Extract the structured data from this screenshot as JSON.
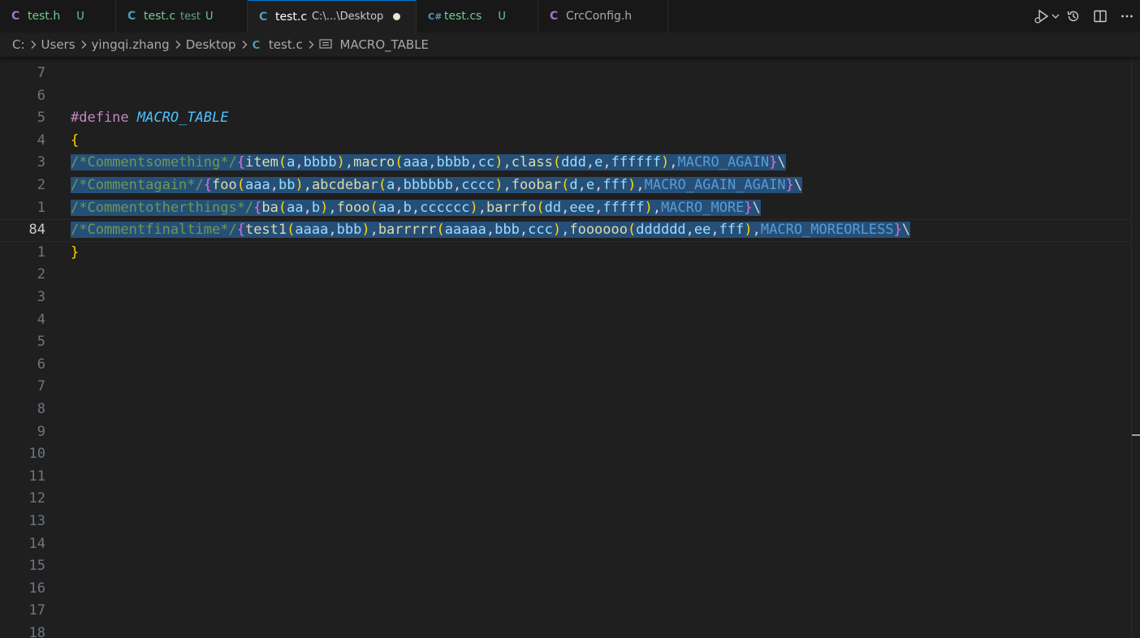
{
  "colors": {
    "tab_c_icon": "#519aba",
    "tab_h_icon": "#a074c4",
    "tab_untracked": "#73c991",
    "keyword": "#c586c0",
    "macro_name": "#4fc1ff",
    "brace": "#ffd700",
    "paren": "#da70d6",
    "comment": "#6a9955",
    "function": "#dcdcaa",
    "identifier": "#9cdcfe",
    "macro_ref": "#569cd6",
    "punct": "#d4d4d4",
    "selection": "#264f78"
  },
  "tabs": [
    {
      "icon": "C",
      "icon_color": "#a074c4",
      "label": "test.h",
      "label_color": "#73c991",
      "description": "",
      "status": "U",
      "status_color": "#73c991",
      "width": 143,
      "active": false,
      "dirty": false
    },
    {
      "icon": "C",
      "icon_color": "#519aba",
      "label": "test.c",
      "label_color": "#73c991",
      "description": "test",
      "status": "U",
      "status_color": "#73c991",
      "width": 162,
      "active": false,
      "dirty": false
    },
    {
      "icon": "C",
      "icon_color": "#519aba",
      "label": "test.c",
      "label_color": "#ffffff",
      "description": "C:\\...\\Desktop",
      "status": "",
      "status_color": "",
      "width": 208,
      "active": true,
      "dirty": true
    },
    {
      "icon": "C#",
      "icon_color": "#519aba",
      "label": "test.cs",
      "label_color": "#73c991",
      "description": "",
      "status": "U",
      "status_color": "#73c991",
      "width": 150,
      "active": false,
      "dirty": false
    },
    {
      "icon": "C",
      "icon_color": "#a074c4",
      "label": "CrcConfig.h",
      "label_color": "#a9a9a9",
      "description": "",
      "status": "",
      "status_color": "",
      "width": 160,
      "active": false,
      "dirty": false
    }
  ],
  "tab_actions": [
    "run-debug-icon",
    "chevron-down-icon",
    "history-icon",
    "split-editor-icon",
    "more-actions-icon"
  ],
  "breadcrumb": {
    "segments": [
      "C:",
      "Users",
      "yingqi.zhang",
      "Desktop"
    ],
    "file": "test.c",
    "symbol": "MACRO_TABLE"
  },
  "editor": {
    "current_line": "84",
    "lines": [
      {
        "num": "7",
        "tokens": []
      },
      {
        "num": "6",
        "tokens": []
      },
      {
        "num": "5",
        "tokens": [
          {
            "t": "#define",
            "c": "keyword"
          },
          {
            "t": " ",
            "c": "punct"
          },
          {
            "t": "MACRO_TABLE",
            "c": "macro_name",
            "i": true
          }
        ]
      },
      {
        "num": "4",
        "tokens": [
          {
            "t": "{",
            "c": "brace"
          }
        ]
      },
      {
        "num": "3",
        "sel": true,
        "tokens": [
          {
            "t": "/*Commentsomething*/",
            "c": "comment"
          },
          {
            "t": "{",
            "c": "paren"
          },
          {
            "t": "item",
            "c": "function"
          },
          {
            "t": "(",
            "c": "brace"
          },
          {
            "t": "a",
            "c": "identifier"
          },
          {
            "t": ",",
            "c": "punct"
          },
          {
            "t": "bbbb",
            "c": "identifier"
          },
          {
            "t": ")",
            "c": "brace"
          },
          {
            "t": ",",
            "c": "punct"
          },
          {
            "t": "macro",
            "c": "function"
          },
          {
            "t": "(",
            "c": "brace"
          },
          {
            "t": "aaa",
            "c": "identifier"
          },
          {
            "t": ",",
            "c": "punct"
          },
          {
            "t": "bbbb",
            "c": "identifier"
          },
          {
            "t": ",",
            "c": "punct"
          },
          {
            "t": "cc",
            "c": "identifier"
          },
          {
            "t": ")",
            "c": "brace"
          },
          {
            "t": ",",
            "c": "punct"
          },
          {
            "t": "class",
            "c": "function"
          },
          {
            "t": "(",
            "c": "brace"
          },
          {
            "t": "ddd",
            "c": "identifier"
          },
          {
            "t": ",",
            "c": "punct"
          },
          {
            "t": "e",
            "c": "identifier"
          },
          {
            "t": ",",
            "c": "punct"
          },
          {
            "t": "ffffff",
            "c": "identifier"
          },
          {
            "t": ")",
            "c": "brace"
          },
          {
            "t": ",",
            "c": "punct"
          },
          {
            "t": "MACRO_AGAIN",
            "c": "macro_ref"
          },
          {
            "t": "}",
            "c": "paren"
          },
          {
            "t": "\\",
            "c": "punct"
          }
        ]
      },
      {
        "num": "2",
        "sel": true,
        "tokens": [
          {
            "t": "/*Commentagain*/",
            "c": "comment"
          },
          {
            "t": "{",
            "c": "paren"
          },
          {
            "t": "foo",
            "c": "function"
          },
          {
            "t": "(",
            "c": "brace"
          },
          {
            "t": "aaa",
            "c": "identifier"
          },
          {
            "t": ",",
            "c": "punct"
          },
          {
            "t": "bb",
            "c": "identifier"
          },
          {
            "t": ")",
            "c": "brace"
          },
          {
            "t": ",",
            "c": "punct"
          },
          {
            "t": "abcdebar",
            "c": "function"
          },
          {
            "t": "(",
            "c": "brace"
          },
          {
            "t": "a",
            "c": "identifier"
          },
          {
            "t": ",",
            "c": "punct"
          },
          {
            "t": "bbbbbb",
            "c": "identifier"
          },
          {
            "t": ",",
            "c": "punct"
          },
          {
            "t": "cccc",
            "c": "identifier"
          },
          {
            "t": ")",
            "c": "brace"
          },
          {
            "t": ",",
            "c": "punct"
          },
          {
            "t": "foobar",
            "c": "function"
          },
          {
            "t": "(",
            "c": "brace"
          },
          {
            "t": "d",
            "c": "identifier"
          },
          {
            "t": ",",
            "c": "punct"
          },
          {
            "t": "e",
            "c": "identifier"
          },
          {
            "t": ",",
            "c": "punct"
          },
          {
            "t": "fff",
            "c": "identifier"
          },
          {
            "t": ")",
            "c": "brace"
          },
          {
            "t": ",",
            "c": "punct"
          },
          {
            "t": "MACRO_AGAIN_AGAIN",
            "c": "macro_ref"
          },
          {
            "t": "}",
            "c": "paren"
          },
          {
            "t": "\\",
            "c": "punct"
          }
        ]
      },
      {
        "num": "1",
        "sel": true,
        "tokens": [
          {
            "t": "/*Commentotherthings*/",
            "c": "comment"
          },
          {
            "t": "{",
            "c": "paren"
          },
          {
            "t": "ba",
            "c": "function"
          },
          {
            "t": "(",
            "c": "brace"
          },
          {
            "t": "aa",
            "c": "identifier"
          },
          {
            "t": ",",
            "c": "punct"
          },
          {
            "t": "b",
            "c": "identifier"
          },
          {
            "t": ")",
            "c": "brace"
          },
          {
            "t": ",",
            "c": "punct"
          },
          {
            "t": "fooo",
            "c": "function"
          },
          {
            "t": "(",
            "c": "brace"
          },
          {
            "t": "aa",
            "c": "identifier"
          },
          {
            "t": ",",
            "c": "punct"
          },
          {
            "t": "b",
            "c": "identifier"
          },
          {
            "t": ",",
            "c": "punct"
          },
          {
            "t": "cccccc",
            "c": "identifier"
          },
          {
            "t": ")",
            "c": "brace"
          },
          {
            "t": ",",
            "c": "punct"
          },
          {
            "t": "barrfo",
            "c": "function"
          },
          {
            "t": "(",
            "c": "brace"
          },
          {
            "t": "dd",
            "c": "identifier"
          },
          {
            "t": ",",
            "c": "punct"
          },
          {
            "t": "eee",
            "c": "identifier"
          },
          {
            "t": ",",
            "c": "punct"
          },
          {
            "t": "fffff",
            "c": "identifier"
          },
          {
            "t": ")",
            "c": "brace"
          },
          {
            "t": ",",
            "c": "punct"
          },
          {
            "t": "MACRO_MORE",
            "c": "macro_ref"
          },
          {
            "t": "}",
            "c": "paren"
          },
          {
            "t": "\\",
            "c": "punct"
          }
        ]
      },
      {
        "num": "84",
        "sel": true,
        "current": true,
        "tokens": [
          {
            "t": "/*Commentfinaltime*/",
            "c": "comment"
          },
          {
            "t": "{",
            "c": "paren"
          },
          {
            "t": "test1",
            "c": "function"
          },
          {
            "t": "(",
            "c": "brace"
          },
          {
            "t": "aaaa",
            "c": "identifier"
          },
          {
            "t": ",",
            "c": "punct"
          },
          {
            "t": "bbb",
            "c": "identifier"
          },
          {
            "t": ")",
            "c": "brace"
          },
          {
            "t": ",",
            "c": "punct"
          },
          {
            "t": "barrrrr",
            "c": "function"
          },
          {
            "t": "(",
            "c": "brace"
          },
          {
            "t": "aaaaa",
            "c": "identifier"
          },
          {
            "t": ",",
            "c": "punct"
          },
          {
            "t": "bbb",
            "c": "identifier"
          },
          {
            "t": ",",
            "c": "punct"
          },
          {
            "t": "ccc",
            "c": "identifier"
          },
          {
            "t": ")",
            "c": "brace"
          },
          {
            "t": ",",
            "c": "punct"
          },
          {
            "t": "foooooo",
            "c": "function"
          },
          {
            "t": "(",
            "c": "brace"
          },
          {
            "t": "dddddd",
            "c": "identifier"
          },
          {
            "t": ",",
            "c": "punct"
          },
          {
            "t": "ee",
            "c": "identifier"
          },
          {
            "t": ",",
            "c": "punct"
          },
          {
            "t": "fff",
            "c": "identifier"
          },
          {
            "t": ")",
            "c": "brace"
          },
          {
            "t": ",",
            "c": "punct"
          },
          {
            "t": "MACRO_MOREORLESS",
            "c": "macro_ref"
          },
          {
            "t": "}",
            "c": "paren"
          },
          {
            "t": "\\",
            "c": "punct"
          }
        ]
      },
      {
        "num": "1",
        "tokens": [
          {
            "t": "}",
            "c": "brace"
          }
        ]
      },
      {
        "num": "2",
        "tokens": []
      },
      {
        "num": "3",
        "tokens": []
      },
      {
        "num": "4",
        "tokens": []
      },
      {
        "num": "5",
        "tokens": []
      },
      {
        "num": "6",
        "tokens": []
      },
      {
        "num": "7",
        "tokens": []
      },
      {
        "num": "8",
        "tokens": []
      },
      {
        "num": "9",
        "tokens": []
      },
      {
        "num": "10",
        "tokens": []
      },
      {
        "num": "11",
        "tokens": []
      },
      {
        "num": "12",
        "tokens": []
      },
      {
        "num": "13",
        "tokens": []
      },
      {
        "num": "14",
        "tokens": []
      },
      {
        "num": "15",
        "tokens": []
      },
      {
        "num": "16",
        "tokens": []
      },
      {
        "num": "17",
        "tokens": []
      },
      {
        "num": "18",
        "tokens": []
      }
    ]
  }
}
